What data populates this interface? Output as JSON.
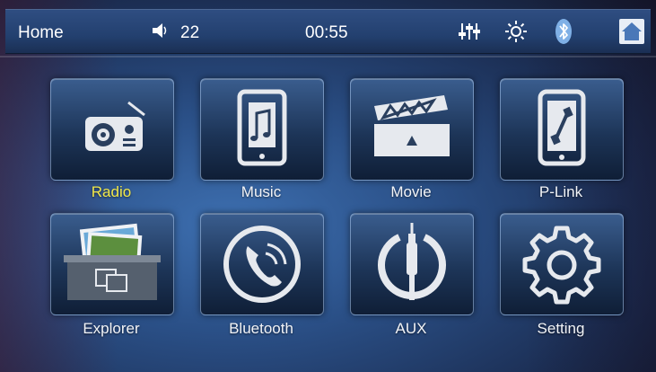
{
  "status_bar": {
    "home_label": "Home",
    "volume": "22",
    "time": "00:55"
  },
  "apps": [
    {
      "label": "Radio",
      "icon": "radio-icon",
      "active": true
    },
    {
      "label": "Music",
      "icon": "music-icon",
      "active": false
    },
    {
      "label": "Movie",
      "icon": "movie-icon",
      "active": false
    },
    {
      "label": "P-Link",
      "icon": "phone-link-icon",
      "active": false
    },
    {
      "label": "Explorer",
      "icon": "folder-photos-icon",
      "active": false
    },
    {
      "label": "Bluetooth",
      "icon": "bluetooth-phone-icon",
      "active": false
    },
    {
      "label": "AUX",
      "icon": "aux-cable-icon",
      "active": false
    },
    {
      "label": "Setting",
      "icon": "gear-icon",
      "active": false
    }
  ],
  "colors": {
    "active_label": "#f2e84a",
    "label": "#f2f4f8",
    "icon": "#e6e9ee"
  }
}
